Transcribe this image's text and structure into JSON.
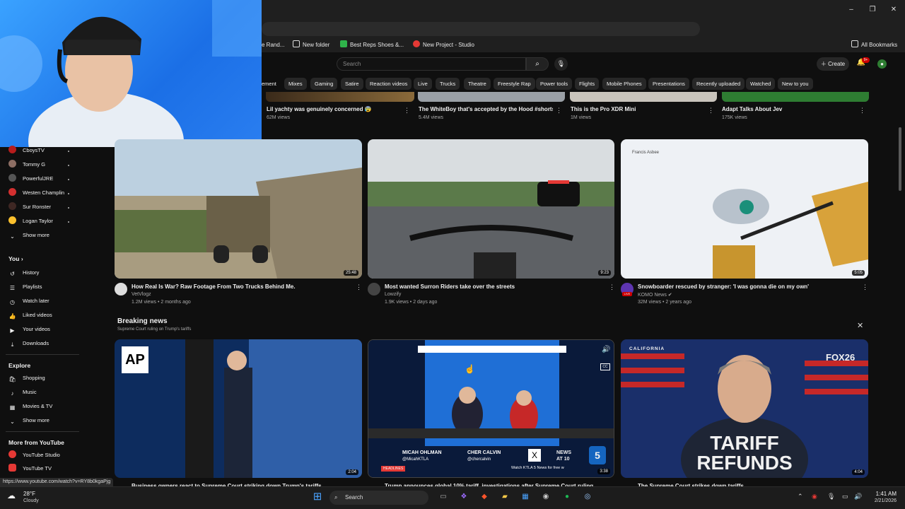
{
  "browser": {
    "bookmarks": [
      {
        "label": "e Rand...",
        "icon": "bookmark-icon"
      },
      {
        "label": "New folder",
        "icon": "folder-icon"
      },
      {
        "label": "Best Reps Shoes &...",
        "icon": "green-site-icon",
        "color": "#2fb34a"
      },
      {
        "label": "New Project - Studio",
        "icon": "red-site-icon",
        "color": "#e53935"
      }
    ],
    "all_bookmarks": "All Bookmarks"
  },
  "header": {
    "search_placeholder": "Search",
    "create_label": "Create",
    "notifications": "9+"
  },
  "chips": [
    "ement",
    "Mixes",
    "Gaming",
    "Satire",
    "Reaction videos",
    "Live",
    "Trucks",
    "Theatre",
    "Freestyle Rap",
    "Power tools",
    "Flights",
    "Mobile Phones",
    "Presentations",
    "Recently uploaded",
    "Watched",
    "New to you"
  ],
  "sidebar": {
    "subscriptions": [
      {
        "label": "CboysTV"
      },
      {
        "label": "Tommy G"
      },
      {
        "label": "PowerfulJRE"
      },
      {
        "label": "Westen Champlin"
      },
      {
        "label": "Sur Ronster"
      },
      {
        "label": "Logan Taylor"
      }
    ],
    "show_more": "Show more",
    "you_label": "You",
    "you_items": [
      "History",
      "Playlists",
      "Watch later",
      "Liked videos",
      "Your videos",
      "Downloads"
    ],
    "explore_label": "Explore",
    "explore_items": [
      "Shopping",
      "Music",
      "Movies & TV"
    ],
    "explore_more": "Show more",
    "more_label": "More from YouTube",
    "more_items": [
      "YouTube Studio",
      "YouTube TV"
    ]
  },
  "top_row": [
    {
      "title": "Lil yachty was genuinely concerned 😰",
      "sub": "62M views"
    },
    {
      "title": "The WhiteBoy that's accepted by the Hood #shorts",
      "sub": "5.4M views"
    },
    {
      "title": "This is the Pro XDR Mini",
      "sub": "1M views"
    },
    {
      "title": "Adapt Talks About Jev",
      "sub": "175K views"
    }
  ],
  "videos": [
    {
      "title": "How Real Is War? Raw Footage From Two Trucks Behind Me.",
      "channel": "VetVlogz",
      "sub": "1.2M views • 2 months ago",
      "duration": "25:48"
    },
    {
      "title": "Most wanted Surron Riders take over the streets",
      "channel": "Lowzify",
      "sub": "1.9K views • 2 days ago",
      "duration": "9:23"
    },
    {
      "title": "Snowboarder rescued by stranger: 'I was gonna die on my own'",
      "channel": "KOMO News",
      "sub": "32M views • 2 years ago",
      "duration": "5:05",
      "thumb_text": "Francis Asbee"
    }
  ],
  "breaking": {
    "title": "Breaking news",
    "subtitle": "Supreme Court ruling on Trump's tariffs",
    "cards": [
      {
        "title": "Business owners react to Supreme Court striking down Trump's tariffs",
        "duration": "2:04",
        "logo": "AP"
      },
      {
        "title": "Trump announces global 10% tariff, investigations after Supreme Court ruling",
        "duration": "3:38",
        "anchor1": "MICAH OHLMAN",
        "anchor1_handle": "@MicahKTLA",
        "anchor2": "CHER CALVIN",
        "anchor2_handle": "@chercalvin",
        "news_label": "NEWS",
        "news_time": "AT 10",
        "headlines": "HEADLINES",
        "ticker": "Watch KTLA 5 News for free w"
      },
      {
        "title": "The Supreme Court strikes down tariffs",
        "duration": "4:04",
        "state_label": "CALIFORNIA",
        "logo": "FOX26",
        "big_text_1": "TARIFF",
        "big_text_2": "REFUNDS"
      }
    ]
  },
  "status_url": "https://www.youtube.com/watch?v=RY8b0kgaPjg",
  "taskbar": {
    "weather_temp": "28°F",
    "weather_desc": "Cloudy",
    "search": "Search",
    "time": "1:41 AM",
    "date": "2/21/2026"
  }
}
